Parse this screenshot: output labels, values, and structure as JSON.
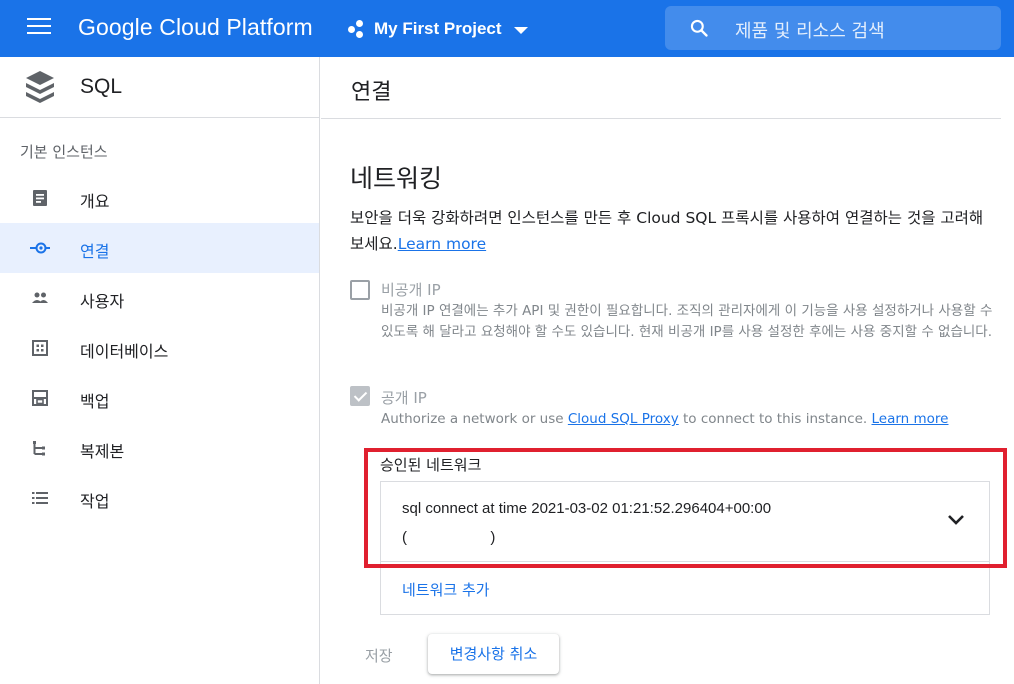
{
  "topbar": {
    "brand": "Google Cloud Platform",
    "project": "My First Project",
    "search_placeholder": "제품 및 리소스 검색",
    "color": "#1a73e8"
  },
  "sidebar": {
    "title": "SQL",
    "section_label": "기본 인스턴스",
    "items": [
      {
        "label": "개요",
        "icon": "overview-icon",
        "active": false
      },
      {
        "label": "연결",
        "icon": "connections-icon",
        "active": true
      },
      {
        "label": "사용자",
        "icon": "users-icon",
        "active": false
      },
      {
        "label": "데이터베이스",
        "icon": "database-icon",
        "active": false
      },
      {
        "label": "백업",
        "icon": "backup-icon",
        "active": false
      },
      {
        "label": "복제본",
        "icon": "replicas-icon",
        "active": false
      },
      {
        "label": "작업",
        "icon": "operations-icon",
        "active": false
      }
    ]
  },
  "main": {
    "title": "연결",
    "section_title": "네트워킹",
    "intro_text": "보안을 더욱 강화하려면 인스턴스를 만든 후 Cloud SQL 프록시를 사용하여 연결하는 것을 고려해 보세요.",
    "intro_link": "Learn more",
    "private_ip": {
      "label": "비공개 IP",
      "checked": false,
      "description": "비공개 IP 연결에는 추가 API 및 권한이 필요합니다. 조직의 관리자에게 이 기능을 사용 설정하거나 사용할 수 있도록 해 달라고 요청해야 할 수도 있습니다. 현재 비공개 IP를 사용 설정한 후에는 사용 중지할 수 없습니다."
    },
    "public_ip": {
      "label": "공개 IP",
      "checked": true,
      "desc_prefix": "Authorize a network or use ",
      "desc_link": "Cloud SQL Proxy",
      "desc_suffix": " to connect to this instance. ",
      "desc_link2": "Learn more"
    },
    "authorized_networks": {
      "label": "승인된 네트워크",
      "items": [
        {
          "name": "sql connect at time 2021-03-02 01:21:52.296404+00:00",
          "ip": "(                    )"
        }
      ],
      "add_label": "네트워크 추가"
    },
    "actions": {
      "save": "저장",
      "cancel": "변경사항 취소"
    }
  }
}
